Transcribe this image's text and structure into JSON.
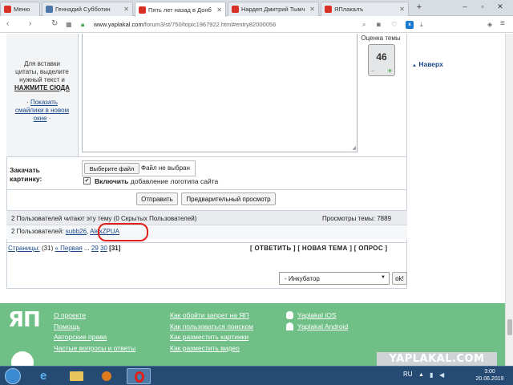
{
  "browser": {
    "tabs": [
      {
        "label": "Меню",
        "color": "#d93025"
      },
      {
        "label": "Геннадий Субботин",
        "color": "#4a76a8"
      },
      {
        "label": "Пять лет назад в Донб",
        "color": "#d93025"
      },
      {
        "label": "Нардеп Дмитрий Тымч",
        "color": "#d93025"
      },
      {
        "label": "ЯПлакалъ",
        "color": "#d93025"
      }
    ],
    "new_tab": "+",
    "url_host": "www.yaplakal.com",
    "url_path": "/forum3/st/750/topic1967922.html#entry82000056",
    "extensions": [
      {
        "name": "abp-icon",
        "label": "ABP",
        "color": "#c0392b"
      },
      {
        "name": "v-icon",
        "label": "V",
        "color": "#1a4a8a"
      },
      {
        "name": "heart-icon",
        "label": "♥",
        "color": "#d94a8c"
      }
    ]
  },
  "reply": {
    "insert_quote_text": [
      "Для вставки",
      "цитаты, выделите",
      "нужный текст и"
    ],
    "insert_quote_link": "НАЖМИТЕ СЮДА",
    "smilies_link": "Показать смайлики в новом окне",
    "rating_label": "Оценка темы",
    "rating_value": "46",
    "to_top": "Наверх"
  },
  "upload": {
    "label": "Закачать картинку:",
    "choose_button": "Выберите файл",
    "no_file": "Файл не выбран",
    "logo_checkbox_bold": "Включить",
    "logo_checkbox_rest": "добавление логотипа сайта",
    "logo_checked": true
  },
  "actions": {
    "send": "Отправить",
    "preview": "Предварительный просмотр"
  },
  "readers": {
    "summary": "2 Пользователей читают эту тему (0 Скрытых Пользователей)",
    "views": "Просмотры темы: 7889",
    "users_prefix": "2 Пользователей:",
    "users": [
      "subb26",
      "AlexZPUA"
    ]
  },
  "pagination": {
    "label": "Страницы:",
    "count": "(31)",
    "first": "« Первая",
    "ellipsis": "...",
    "pages": [
      "29",
      "30"
    ],
    "current": "[31]",
    "reply": "[ ОТВЕТИТЬ ]",
    "new_topic": "[ НОВАЯ ТЕМА ]",
    "poll": "[ ОПРОС ]"
  },
  "forum_jump": {
    "selected": "- Инкубатор",
    "ok": "ok!"
  },
  "footer": {
    "logo": "ЯП",
    "col1": [
      "О проекте",
      "Помощь",
      "Авторские права",
      "Частые вопросы и ответы"
    ],
    "col2": [
      "Как обойти запрет на ЯП",
      "Как пользоваться поиском",
      "Как разместить картинки",
      "Как разместить видео"
    ],
    "col3": [
      "Yaplakal iOS",
      "Yaplakal Android"
    ],
    "watermark": "YAPLAKAL.COM"
  },
  "taskbar": {
    "lang": "RU",
    "time": "3:00",
    "date": "20.06.2019"
  },
  "colors": {
    "footer_bg": "#6fbf86",
    "link": "#1b4a8a",
    "highlight_circle": "#e0211b"
  }
}
